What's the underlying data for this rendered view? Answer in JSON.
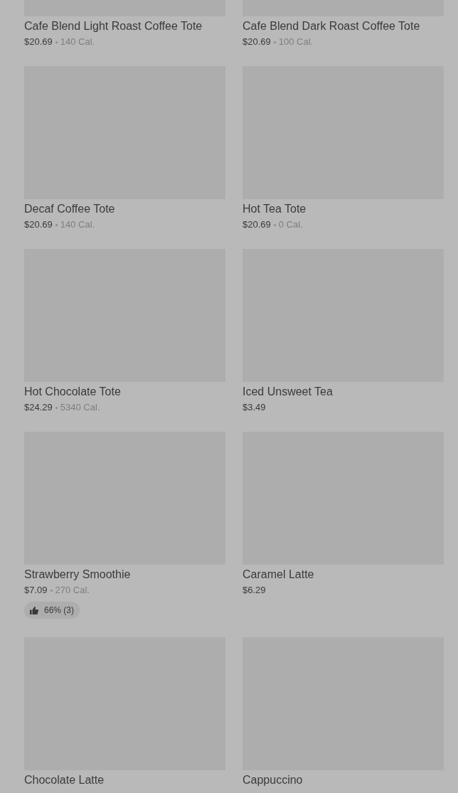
{
  "items": [
    {
      "name": "Cafe Blend Light Roast Coffee Tote",
      "price": "$20.69",
      "calories": "140 Cal."
    },
    {
      "name": "Cafe Blend Dark Roast Coffee Tote",
      "price": "$20.69",
      "calories": "100 Cal."
    },
    {
      "name": "Decaf Coffee Tote",
      "price": "$20.69",
      "calories": "140 Cal."
    },
    {
      "name": "Hot Tea Tote",
      "price": "$20.69",
      "calories": "0 Cal."
    },
    {
      "name": "Hot Chocolate Tote",
      "price": "$24.29",
      "calories": "5340 Cal."
    },
    {
      "name": "Iced Unsweet Tea",
      "price": "$3.49"
    },
    {
      "name": "Strawberry Smoothie",
      "price": "$7.09",
      "calories": "270 Cal.",
      "rating": "66% (3)"
    },
    {
      "name": "Caramel Latte",
      "price": "$6.29"
    },
    {
      "name": "Chocolate Latte"
    },
    {
      "name": "Cappuccino"
    }
  ]
}
